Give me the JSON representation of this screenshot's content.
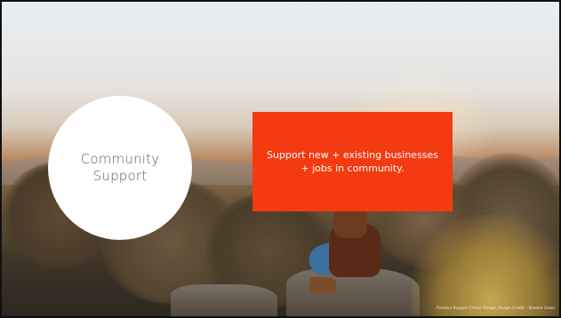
{
  "slide": {
    "circle_label": "Community Support",
    "box_text": "Support new + existing businesses + jobs in community.",
    "photo_credit": "Flinders Ranges Chace Range, Image Credit – Brooke Sawic"
  },
  "colors": {
    "accent_box": "#f43a10",
    "circle_fill": "#ffffff",
    "circle_text": "#595959"
  }
}
